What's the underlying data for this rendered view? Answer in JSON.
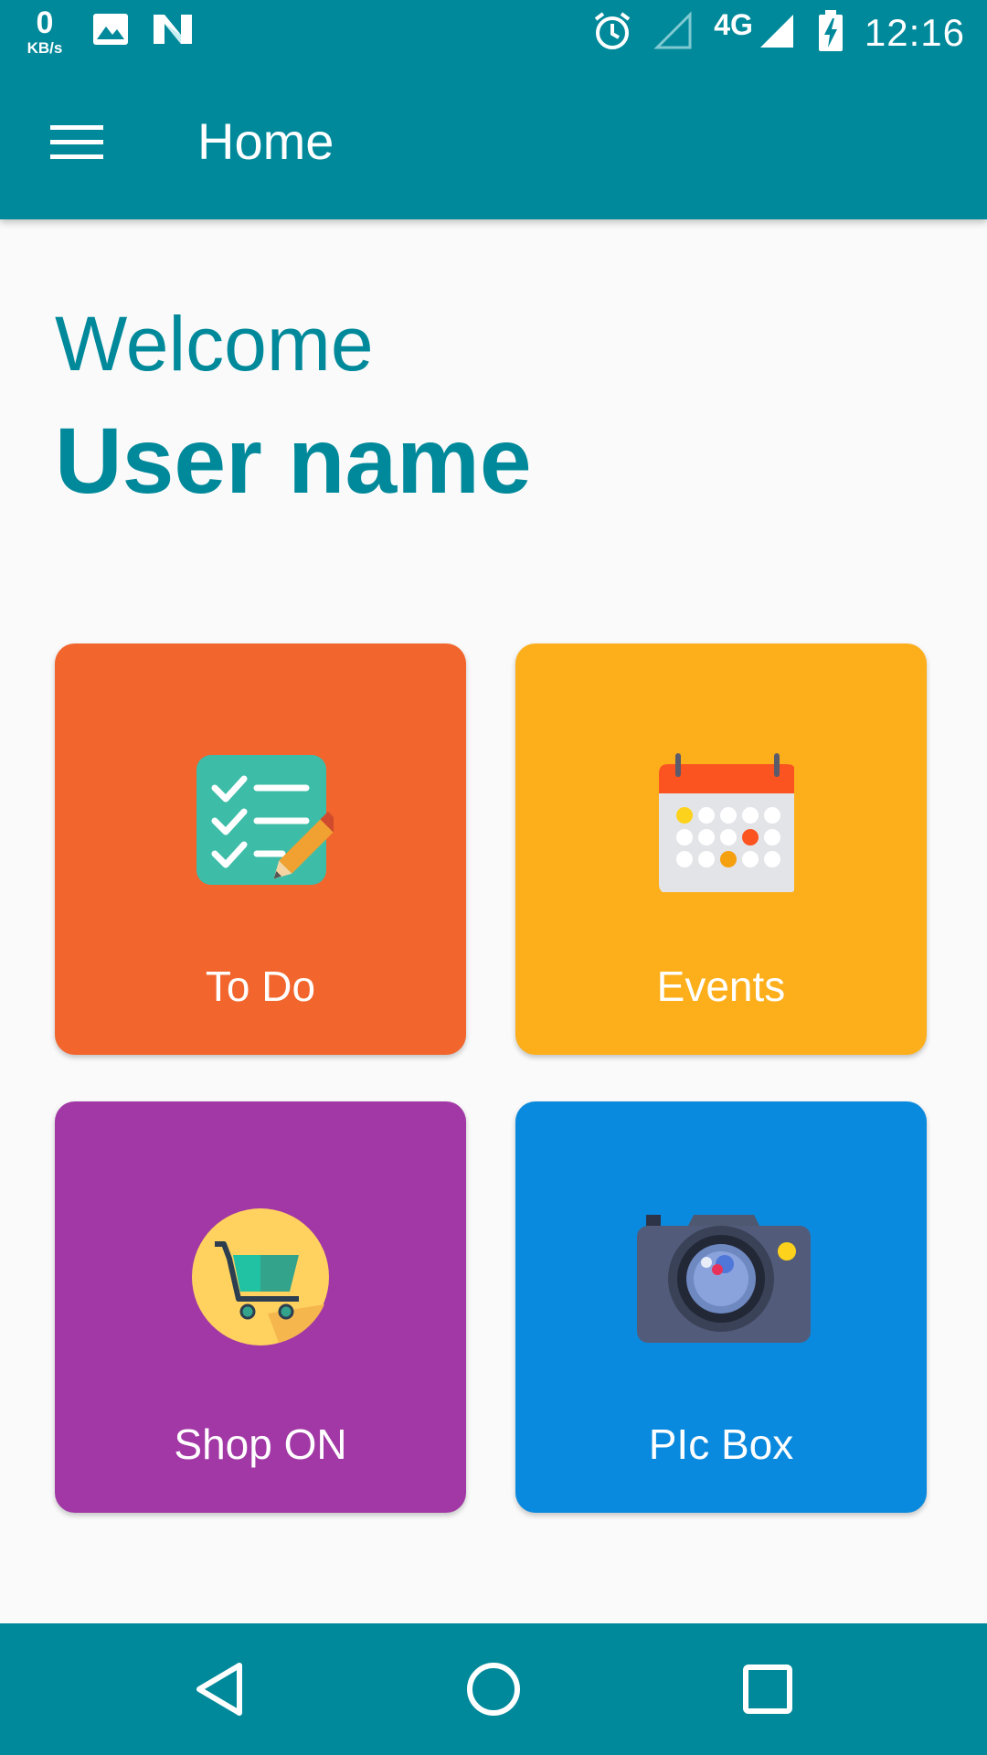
{
  "status_bar": {
    "net_speed_value": "0",
    "net_speed_unit": "KB/s",
    "network_type": "4G",
    "time": "12:16",
    "icons": [
      "image-icon",
      "n-app-icon",
      "alarm-icon",
      "signal-empty-icon",
      "signal-full-icon",
      "battery-charging-icon"
    ]
  },
  "toolbar": {
    "title": "Home",
    "menu_icon": "hamburger-menu-icon"
  },
  "greeting": {
    "welcome": "Welcome",
    "username": "User name"
  },
  "tiles": [
    {
      "label": "To Do",
      "icon": "checklist-icon",
      "color": "#f2652c"
    },
    {
      "label": "Events",
      "icon": "calendar-icon",
      "color": "#fcaf1b"
    },
    {
      "label": "Shop ON",
      "icon": "shopping-cart-icon",
      "color": "#a238a5"
    },
    {
      "label": "PIc Box",
      "icon": "camera-icon",
      "color": "#0a8ade"
    }
  ],
  "nav_bar": {
    "icons": [
      "back-icon",
      "home-icon",
      "recents-icon"
    ]
  },
  "colors": {
    "primary": "#00899a",
    "background": "#fafafa"
  }
}
